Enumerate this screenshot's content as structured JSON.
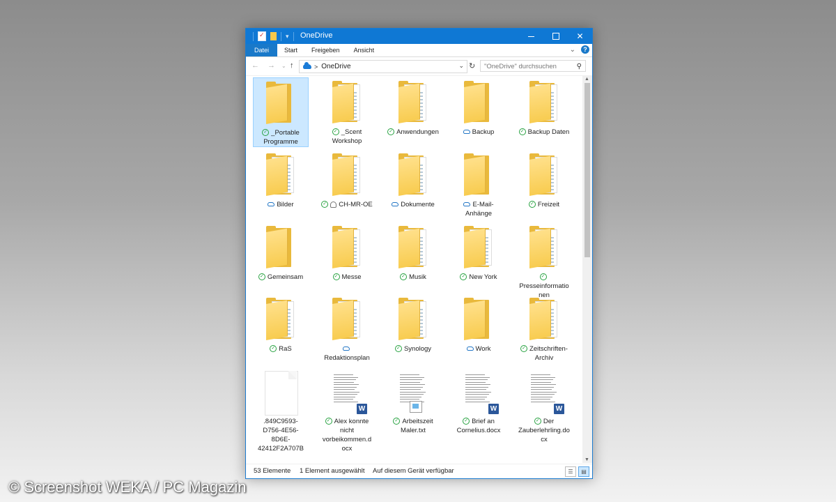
{
  "window": {
    "title": "OneDrive",
    "controls": {
      "minimize": "—",
      "maximize": "☐",
      "close": "✕"
    }
  },
  "ribbon": {
    "tabs": [
      "Datei",
      "Start",
      "Freigeben",
      "Ansicht"
    ],
    "active_tab": "Datei",
    "help": "?"
  },
  "navigation": {
    "back": "←",
    "forward": "→",
    "recent": "⌄",
    "up": "↑",
    "breadcrumb_sep": ">",
    "location": "OneDrive",
    "refresh": "↻",
    "search_placeholder": "\"OneDrive\" durchsuchen"
  },
  "items": [
    {
      "label": "_Portable Programme",
      "status": "synced",
      "kind": "folder",
      "selected": true
    },
    {
      "label": "_Scent Workshop",
      "status": "synced",
      "kind": "folder-docs"
    },
    {
      "label": "Anwendungen",
      "status": "synced",
      "kind": "folder-docs"
    },
    {
      "label": "Backup",
      "status": "cloud",
      "kind": "folder"
    },
    {
      "label": "Backup Daten",
      "status": "synced",
      "kind": "folder-docs"
    },
    {
      "label": "Bilder",
      "status": "cloud",
      "kind": "folder-img"
    },
    {
      "label": "CH-MR-OE",
      "status": "synced",
      "shared": true,
      "kind": "folder-docs"
    },
    {
      "label": "Dokumente",
      "status": "cloud",
      "kind": "folder-img"
    },
    {
      "label": "E-Mail-Anhänge",
      "status": "cloud",
      "kind": "folder"
    },
    {
      "label": "Freizeit",
      "status": "synced",
      "kind": "folder-docs"
    },
    {
      "label": "Gemeinsam",
      "status": "synced",
      "kind": "folder"
    },
    {
      "label": "Messe",
      "status": "synced",
      "kind": "folder-docs"
    },
    {
      "label": "Musik",
      "status": "synced",
      "kind": "folder-docs"
    },
    {
      "label": "New York",
      "status": "synced",
      "kind": "folder-img"
    },
    {
      "label": "Presseinformationen",
      "status": "synced",
      "kind": "folder-img"
    },
    {
      "label": "RaS",
      "status": "synced",
      "kind": "folder-img"
    },
    {
      "label": "Redaktionsplan",
      "status": "cloud",
      "kind": "folder-docs"
    },
    {
      "label": "Synology",
      "status": "synced",
      "kind": "folder-docs"
    },
    {
      "label": "Work",
      "status": "cloud",
      "kind": "folder"
    },
    {
      "label": "Zeitschriften-Archiv",
      "status": "synced",
      "kind": "folder-docs"
    },
    {
      "label": ".849C9593-D756-4E56-8D6E-42412F2A707B",
      "status": "",
      "kind": "blank"
    },
    {
      "label": "Alex konnte nicht vorbeikommen.docx",
      "status": "synced",
      "kind": "word"
    },
    {
      "label": "Arbeitszeit Maler.txt",
      "status": "synced",
      "kind": "txt"
    },
    {
      "label": "Brief an Cornelius.docx",
      "status": "synced",
      "kind": "word"
    },
    {
      "label": "Der Zauberlehrling.docx",
      "status": "synced",
      "kind": "word"
    }
  ],
  "status_bar": {
    "count": "53 Elemente",
    "selection": "1 Element ausgewählt",
    "availability": "Auf diesem Gerät verfügbar"
  },
  "watermark": "© Screenshot WEKA / PC Magazin",
  "colors": {
    "accent": "#0f78d4",
    "folder": "#f8cc50",
    "synced": "#27a240",
    "cloud": "#2276c5"
  }
}
